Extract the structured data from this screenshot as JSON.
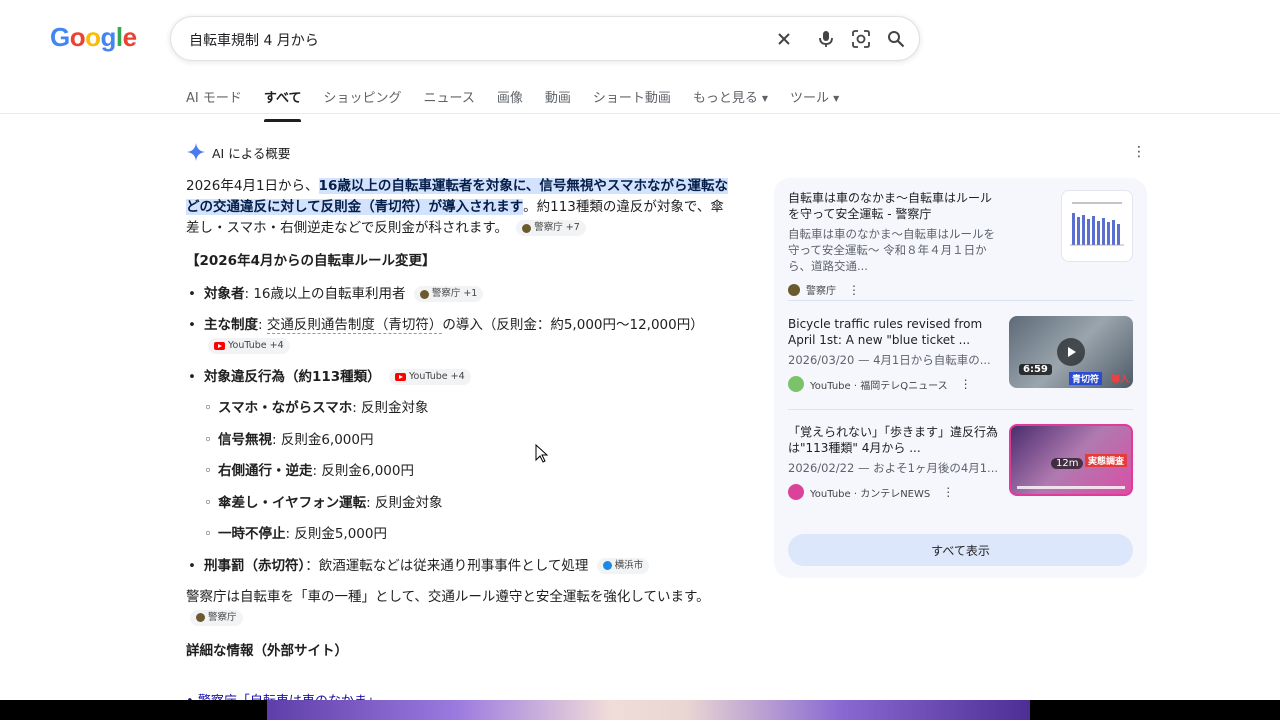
{
  "logo": "Google",
  "search": {
    "query": "自転車規制 4 月から"
  },
  "tabs": [
    {
      "label": "AI モード"
    },
    {
      "label": "すべて"
    },
    {
      "label": "ショッピング"
    },
    {
      "label": "ニュース"
    },
    {
      "label": "画像"
    },
    {
      "label": "動画"
    },
    {
      "label": "ショート動画"
    },
    {
      "label": "もっと見る"
    },
    {
      "label": "ツール"
    }
  ],
  "ai": {
    "header": "AI による概要",
    "intro_pre": "2026年4月1日から、",
    "intro_hl": "16歳以上の自転車運転者を対象に、信号無視やスマホながら運転などの交通違反に対して反則金（青切符）が導入されます",
    "intro_post": "。約113種類の違反が対象で、傘差し・スマホ・右側逆走などで反則金が科されます。",
    "chip_police7": "警察庁 +7",
    "section_title": "【2026年4月からの自転車ルール変更】",
    "items": [
      {
        "label": "対象者",
        "text": ": 16歳以上の自転車利用者",
        "chip": "警察庁 +1"
      },
      {
        "label": "主な制度",
        "text_a": ": ",
        "text_link": "交通反則通告制度（青切符）",
        "text_b": "の導入（反則金：約5,000円〜12,000円）",
        "chip": "YouTube +4"
      },
      {
        "label": "対象違反行為（約113種類）",
        "chip": "YouTube +4"
      },
      {
        "label": "刑事罰（赤切符）",
        "text": "：飲酒運転などは従来通り刑事事件として処理",
        "chip": "横浜市"
      }
    ],
    "sub_items": [
      {
        "label": "スマホ・ながらスマホ",
        "text": ": 反則金対象"
      },
      {
        "label": "信号無視",
        "text": ": 反則金6,000円"
      },
      {
        "label": "右側通行・逆走",
        "text": ": 反則金6,000円"
      },
      {
        "label": "傘差し・イヤフォン運転",
        "text": ": 反則金対象"
      },
      {
        "label": "一時不停止",
        "text": ": 反則金5,000円"
      }
    ],
    "closing": "警察庁は自転車を「車の一種」として、交通ルール遵守と安全運転を強化しています。",
    "closing_chip": "警察庁",
    "detail_title": "詳細な情報（外部サイト）",
    "detail_link": "警察庁「自転車は車のなかま」"
  },
  "panel": {
    "cards": [
      {
        "title": "自転車は車のなかま〜自転車はルールを守って安全運転 - 警察庁",
        "snippet": "自転車は車のなかま〜自転車はルールを守って安全運転〜 令和８年４月１日から、道路交通...",
        "source": "警察庁"
      },
      {
        "title": "Bicycle traffic rules revised from April 1st: A new \"blue ticket ...",
        "snippet": "2026/03/20 — 4月1日から自転車の...",
        "source": "YouTube · 福岡テレQニュース",
        "duration": "6:59",
        "thumb_caption": "青切符",
        "thumb_caption2": "導入"
      },
      {
        "title": "「覚えられない」「歩きます」違反行為は\"113種類\" 4月から ...",
        "snippet": "2026/02/22 — およそ1ヶ月後の4月1...",
        "source": "YouTube · カンテレNEWS",
        "duration": "12m",
        "thumb_caption": "実態調査"
      }
    ],
    "show_all": "すべて表示"
  }
}
